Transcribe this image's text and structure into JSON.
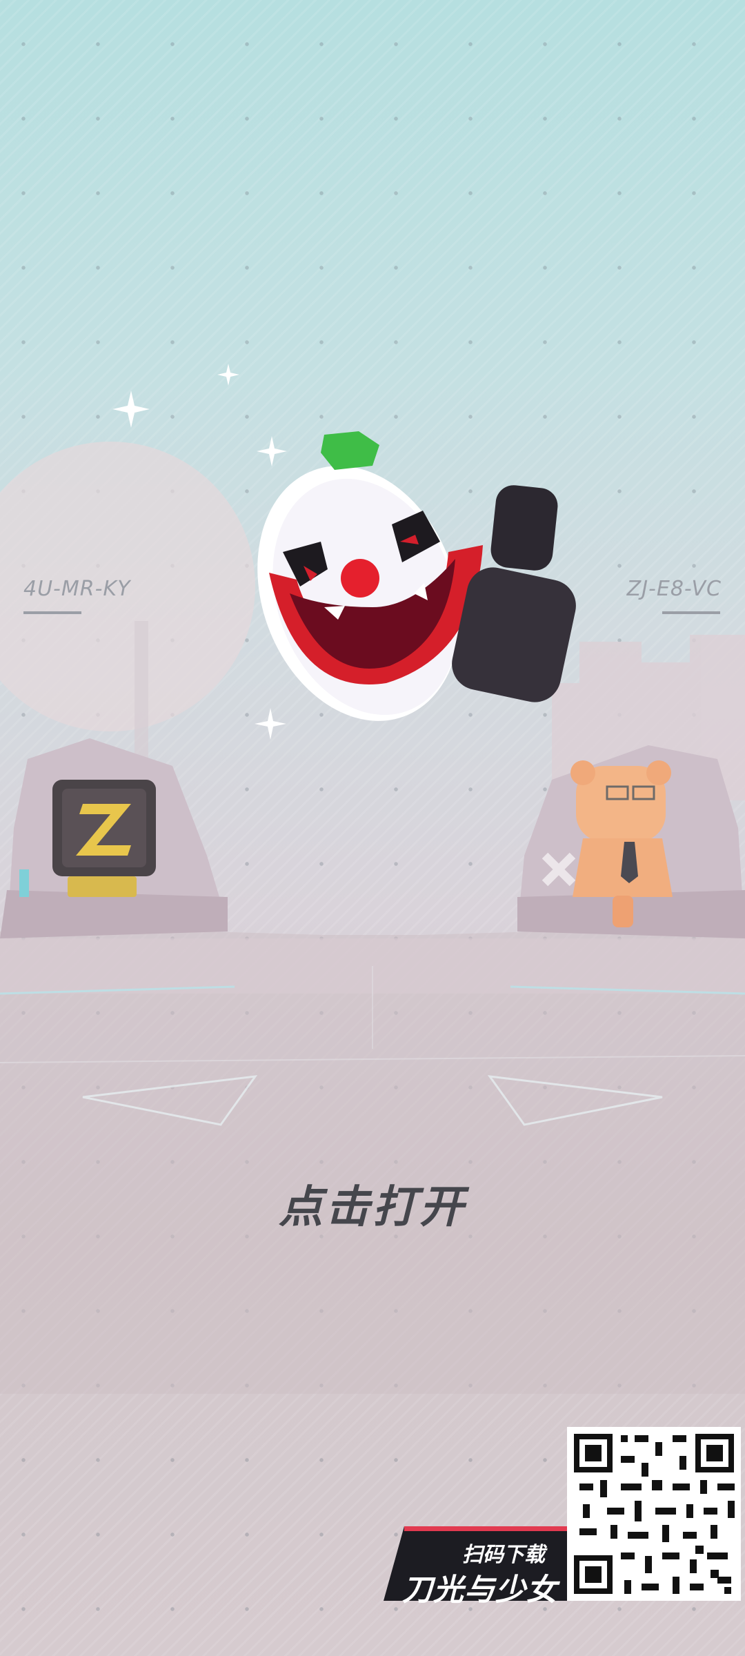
{
  "room_codes": {
    "left": "4U-MR-KY",
    "right": "ZJ-E8-VC"
  },
  "prompt": {
    "label": "点击打开"
  },
  "download_badge": {
    "scan_label": "扫码下载",
    "game_title": "刀光与少女"
  },
  "icons": {
    "reward_item": "clown-mask-icon",
    "left_avatar": "z-badge-icon",
    "right_avatar": "orange-bear-icon",
    "qr": "qr-code-icon"
  },
  "colors": {
    "accent_red": "#e23a50",
    "cta_text": "#45464c",
    "badge_bg": "#1c1c22"
  }
}
